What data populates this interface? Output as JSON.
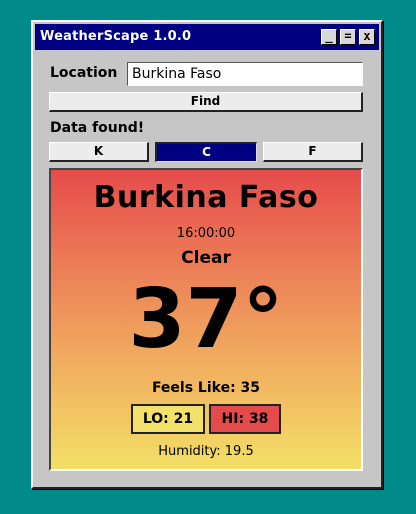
{
  "window": {
    "title": "WeatherScape 1.0.0",
    "controls": {
      "minimize": "_",
      "maximize": "=",
      "close": "x"
    }
  },
  "search": {
    "location_label": "Location",
    "location_value": "Burkina Faso",
    "find_label": "Find"
  },
  "status": "Data found!",
  "units": {
    "options": [
      "K",
      "C",
      "F"
    ],
    "selected": "C"
  },
  "weather": {
    "city": "Burkina Faso",
    "time": "16:00:00",
    "condition": "Clear",
    "temperature": "37°",
    "feels_like": "Feels Like: 35",
    "low": "LO: 21",
    "high": "HI: 38",
    "humidity": "Humidity: 19.5"
  },
  "colors": {
    "desktop": "#008b8b",
    "titlebar": "#000080",
    "selected_unit": "#000080",
    "gradient_top": "#e64b4b",
    "gradient_bottom": "#f3df67",
    "low_badge": "#f3e169",
    "high_badge": "#e64b4b"
  }
}
